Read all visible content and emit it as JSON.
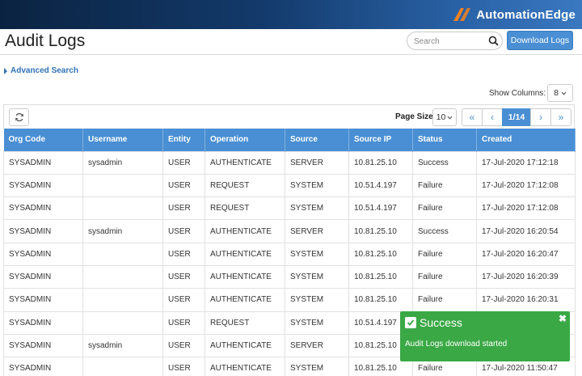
{
  "brand": {
    "name": "AutomationEdge",
    "logo_icon": "automationedge-logo-icon"
  },
  "header": {
    "title": "Audit Logs",
    "search_placeholder": "Search",
    "download_label": "Download Logs"
  },
  "advanced_search": {
    "label": "Advanced Search"
  },
  "show_columns": {
    "label": "Show Columns:",
    "value": "8"
  },
  "toolbar": {
    "page_size_label": "Page Size",
    "page_size_value": "10",
    "current_page": "1/14"
  },
  "table": {
    "columns": [
      "Org Code",
      "Username",
      "Entity",
      "Operation",
      "Source",
      "Source IP",
      "Status",
      "Created"
    ],
    "rows": [
      [
        "SYSADMIN",
        "sysadmin",
        "USER",
        "AUTHENTICATE",
        "SERVER",
        "10.81.25.10",
        "Success",
        "17-Jul-2020 17:12:18"
      ],
      [
        "SYSADMIN",
        "",
        "USER",
        "REQUEST",
        "SYSTEM",
        "10.51.4.197",
        "Failure",
        "17-Jul-2020 17:12:08"
      ],
      [
        "SYSADMIN",
        "",
        "USER",
        "REQUEST",
        "SYSTEM",
        "10.51.4.197",
        "Failure",
        "17-Jul-2020 17:12:08"
      ],
      [
        "SYSADMIN",
        "sysadmin",
        "USER",
        "AUTHENTICATE",
        "SERVER",
        "10.81.25.10",
        "Success",
        "17-Jul-2020 16:20:54"
      ],
      [
        "SYSADMIN",
        "",
        "USER",
        "AUTHENTICATE",
        "SYSTEM",
        "10.81.25.10",
        "Failure",
        "17-Jul-2020 16:20:47"
      ],
      [
        "SYSADMIN",
        "",
        "USER",
        "AUTHENTICATE",
        "SYSTEM",
        "10.81.25.10",
        "Failure",
        "17-Jul-2020 16:20:39"
      ],
      [
        "SYSADMIN",
        "",
        "USER",
        "AUTHENTICATE",
        "SYSTEM",
        "10.81.25.10",
        "Failure",
        "17-Jul-2020 16:20:31"
      ],
      [
        "SYSADMIN",
        "",
        "USER",
        "REQUEST",
        "SYSTEM",
        "10.51.4.197",
        "",
        ""
      ],
      [
        "SYSADMIN",
        "sysadmin",
        "USER",
        "AUTHENTICATE",
        "SERVER",
        "10.81.25.10",
        "",
        ""
      ],
      [
        "SYSADMIN",
        "",
        "USER",
        "AUTHENTICATE",
        "SYSTEM",
        "10.81.25.10",
        "Failure",
        "17-Jul-2020 11:50:47"
      ]
    ]
  },
  "toast": {
    "title": "Success",
    "message": "Audit Logs download started",
    "close": "✖"
  },
  "colors": {
    "accent": "#4a8fd4",
    "success": "#3aa845",
    "header_dark": "#0b2341"
  }
}
